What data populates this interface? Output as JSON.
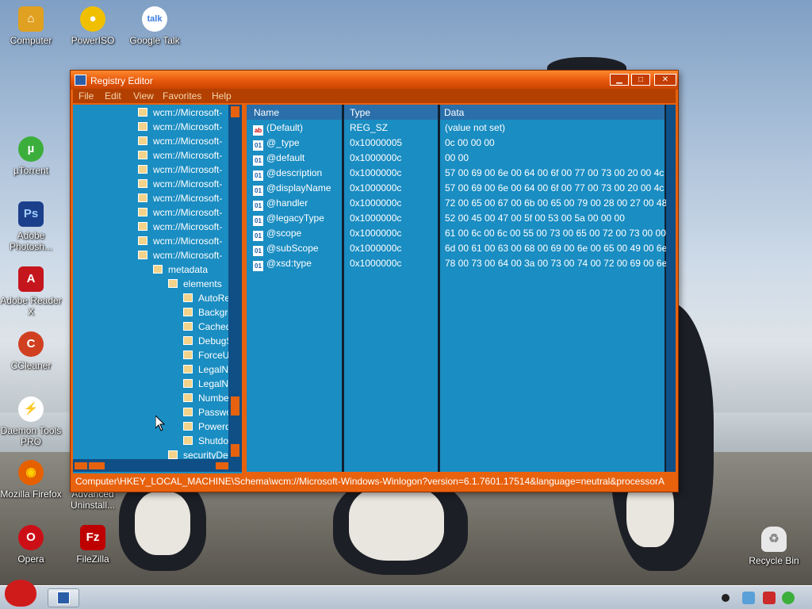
{
  "desktop": {
    "icons": [
      {
        "label": "Computer",
        "icon": "computer-icon",
        "color": "#e0a020"
      },
      {
        "label": "PowerISO",
        "icon": "disc-icon",
        "color": "#f0c000"
      },
      {
        "label": "Google Talk",
        "icon": "talk-icon",
        "color": "#ffffff"
      },
      {
        "label": "µTorrent",
        "icon": "utorrent-icon",
        "color": "#3cae3c"
      },
      {
        "label": "Adobe Photosh...",
        "icon": "photoshop-icon",
        "color": "#1b3f8b"
      },
      {
        "label": "Adobe Reader X",
        "icon": "acrobat-icon",
        "color": "#c4161c"
      },
      {
        "label": "CCleaner",
        "icon": "ccleaner-icon",
        "color": "#d04020"
      },
      {
        "label": "Daemon Tools PRO",
        "icon": "daemon-tools-icon",
        "color": "#e05010"
      },
      {
        "label": "Mozilla Firefox",
        "icon": "firefox-icon",
        "color": "#e66000"
      },
      {
        "label": "Advanced Uninstall...",
        "icon": "uninstaller-icon",
        "color": "#3070c0"
      },
      {
        "label": "Opera",
        "icon": "opera-icon",
        "color": "#cc0f16"
      },
      {
        "label": "FileZilla",
        "icon": "filezilla-icon",
        "color": "#bf0000"
      },
      {
        "label": "Recycle Bin",
        "icon": "recycle-bin-icon",
        "color": "#e8e8e8"
      }
    ]
  },
  "window": {
    "title": "Registry Editor",
    "controls": {
      "minimize": "▁",
      "maximize": "□",
      "close": "✕"
    },
    "menu": [
      "File",
      "Edit",
      "View",
      "Favorites",
      "Help"
    ],
    "tree": [
      {
        "label": "wcm://Microsoft-"
      },
      {
        "label": "wcm://Microsoft-"
      },
      {
        "label": "wcm://Microsoft-"
      },
      {
        "label": "wcm://Microsoft-"
      },
      {
        "label": "wcm://Microsoft-"
      },
      {
        "label": "wcm://Microsoft-"
      },
      {
        "label": "wcm://Microsoft-"
      },
      {
        "label": "wcm://Microsoft-"
      },
      {
        "label": "wcm://Microsoft-"
      },
      {
        "label": "wcm://Microsoft-"
      },
      {
        "label": "wcm://Microsoft-"
      },
      {
        "label": "metadata"
      },
      {
        "label": "elements"
      },
      {
        "label": "AutoRe"
      },
      {
        "label": "Backgro"
      },
      {
        "label": "Cached"
      },
      {
        "label": "DebugS"
      },
      {
        "label": "ForceU"
      },
      {
        "label": "LegalN"
      },
      {
        "label": "LegalN"
      },
      {
        "label": "Numbe"
      },
      {
        "label": "Passwo"
      },
      {
        "label": "Powerd"
      },
      {
        "label": "Shutdo"
      },
      {
        "label": "securityDe"
      }
    ],
    "columns": {
      "name": "Name",
      "type": "Type",
      "data": "Data"
    },
    "values": [
      {
        "name": "(Default)",
        "type": "REG_SZ",
        "data": "(value not set)",
        "kind": "string"
      },
      {
        "name": "@_type",
        "type": "0x10000005",
        "data": "0c 00 00 00",
        "kind": "binary"
      },
      {
        "name": "@default",
        "type": "0x1000000c",
        "data": "00 00",
        "kind": "binary"
      },
      {
        "name": "@description",
        "type": "0x1000000c",
        "data": "57 00 69 00 6e 00 64 00 6f 00 77 00 73 00 20 00 4c 0...",
        "kind": "binary"
      },
      {
        "name": "@displayName",
        "type": "0x1000000c",
        "data": "57 00 69 00 6e 00 64 00 6f 00 77 00 73 00 20 00 4c 0...",
        "kind": "binary"
      },
      {
        "name": "@handler",
        "type": "0x1000000c",
        "data": "72 00 65 00 67 00 6b 00 65 00 79 00 28 00 27 00 48 0...",
        "kind": "binary"
      },
      {
        "name": "@legacyType",
        "type": "0x1000000c",
        "data": "52 00 45 00 47 00 5f 00 53 00 5a 00 00 00",
        "kind": "binary"
      },
      {
        "name": "@scope",
        "type": "0x1000000c",
        "data": "61 00 6c 00 6c 00 55 00 73 00 65 00 72 00 73 00 00 00",
        "kind": "binary"
      },
      {
        "name": "@subScope",
        "type": "0x1000000c",
        "data": "6d 00 61 00 63 00 68 00 69 00 6e 00 65 00 49 00 6e 0...",
        "kind": "binary"
      },
      {
        "name": "@xsd:type",
        "type": "0x1000000c",
        "data": "78 00 73 00 64 00 3a 00 73 00 74 00 72 00 69 00 6e 0...",
        "kind": "binary"
      }
    ],
    "status_path": "Computer\\HKEY_LOCAL_MACHINE\\Schema\\wcm://Microsoft-Windows-Winlogon?version=6.1.7601.17514&language=neutral&processorA"
  },
  "taskbar": {
    "start": "angry-bird-start-icon",
    "apps": [
      "registry-editor-taskbar-icon"
    ],
    "tray": [
      "record-icon",
      "safely-remove-icon",
      "network-error-icon",
      "utorrent-tray-icon"
    ]
  }
}
